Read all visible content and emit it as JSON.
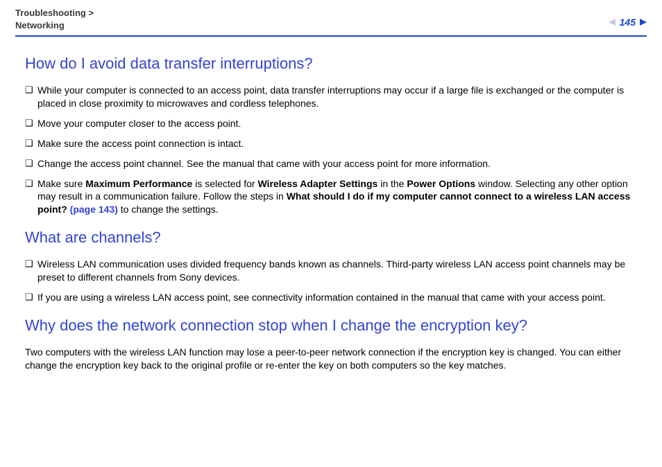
{
  "breadcrumb": {
    "line1": "Troubleshooting >",
    "line2": "Networking"
  },
  "pagenum": "145",
  "sections": [
    {
      "heading": "How do I avoid data transfer interruptions?",
      "bullets": [
        {
          "pre": "While your computer is connected to an access point, data transfer interruptions may occur if a large file is exchanged or the computer is placed in close proximity to microwaves and cordless telephones."
        },
        {
          "pre": "Move your computer closer to the access point."
        },
        {
          "pre": "Make sure the access point connection is intact."
        },
        {
          "pre": "Change the access point channel. See the manual that came with your access point for more information."
        },
        {
          "pre": "Make sure ",
          "b1": "Maximum Performance",
          "mid1": " is selected for ",
          "b2": "Wireless Adapter Settings",
          "mid2": " in the ",
          "b3": "Power Options",
          "mid3": " window. Selecting any other option may result in a communication failure. Follow the steps in ",
          "b4": "What should I do if my computer cannot connect to a wireless LAN access point? ",
          "link": "(page 143)",
          "post": " to change the settings."
        }
      ]
    },
    {
      "heading": "What are channels?",
      "bullets": [
        {
          "pre": "Wireless LAN communication uses divided frequency bands known as channels. Third-party wireless LAN access point channels may be preset to different channels from Sony devices."
        },
        {
          "pre": "If you are using a wireless LAN access point, see connectivity information contained in the manual that came with your access point."
        }
      ]
    },
    {
      "heading": "Why does the network connection stop when I change the encryption key?",
      "para": "Two computers with the wireless LAN function may lose a peer-to-peer network connection if the encryption key is changed. You can either change the encryption key back to the original profile or re-enter the key on both computers so the key matches."
    }
  ]
}
